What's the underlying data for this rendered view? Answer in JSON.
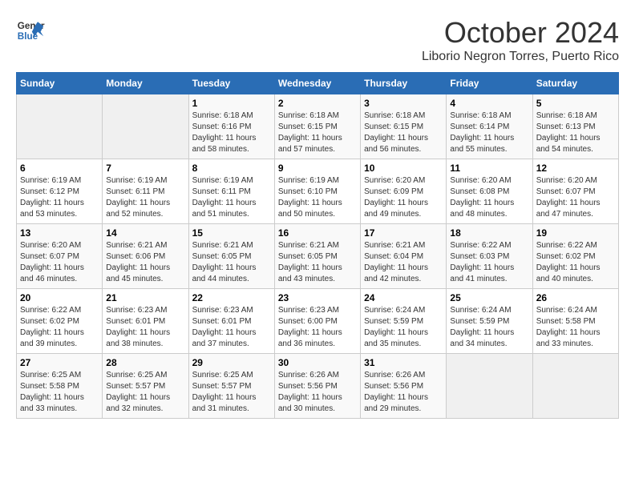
{
  "header": {
    "logo_line1": "General",
    "logo_line2": "Blue",
    "month": "October 2024",
    "location": "Liborio Negron Torres, Puerto Rico"
  },
  "days_of_week": [
    "Sunday",
    "Monday",
    "Tuesday",
    "Wednesday",
    "Thursday",
    "Friday",
    "Saturday"
  ],
  "weeks": [
    [
      {
        "day": "",
        "info": ""
      },
      {
        "day": "",
        "info": ""
      },
      {
        "day": "1",
        "info": "Sunrise: 6:18 AM\nSunset: 6:16 PM\nDaylight: 11 hours and 58 minutes."
      },
      {
        "day": "2",
        "info": "Sunrise: 6:18 AM\nSunset: 6:15 PM\nDaylight: 11 hours and 57 minutes."
      },
      {
        "day": "3",
        "info": "Sunrise: 6:18 AM\nSunset: 6:15 PM\nDaylight: 11 hours and 56 minutes."
      },
      {
        "day": "4",
        "info": "Sunrise: 6:18 AM\nSunset: 6:14 PM\nDaylight: 11 hours and 55 minutes."
      },
      {
        "day": "5",
        "info": "Sunrise: 6:18 AM\nSunset: 6:13 PM\nDaylight: 11 hours and 54 minutes."
      }
    ],
    [
      {
        "day": "6",
        "info": "Sunrise: 6:19 AM\nSunset: 6:12 PM\nDaylight: 11 hours and 53 minutes."
      },
      {
        "day": "7",
        "info": "Sunrise: 6:19 AM\nSunset: 6:11 PM\nDaylight: 11 hours and 52 minutes."
      },
      {
        "day": "8",
        "info": "Sunrise: 6:19 AM\nSunset: 6:11 PM\nDaylight: 11 hours and 51 minutes."
      },
      {
        "day": "9",
        "info": "Sunrise: 6:19 AM\nSunset: 6:10 PM\nDaylight: 11 hours and 50 minutes."
      },
      {
        "day": "10",
        "info": "Sunrise: 6:20 AM\nSunset: 6:09 PM\nDaylight: 11 hours and 49 minutes."
      },
      {
        "day": "11",
        "info": "Sunrise: 6:20 AM\nSunset: 6:08 PM\nDaylight: 11 hours and 48 minutes."
      },
      {
        "day": "12",
        "info": "Sunrise: 6:20 AM\nSunset: 6:07 PM\nDaylight: 11 hours and 47 minutes."
      }
    ],
    [
      {
        "day": "13",
        "info": "Sunrise: 6:20 AM\nSunset: 6:07 PM\nDaylight: 11 hours and 46 minutes."
      },
      {
        "day": "14",
        "info": "Sunrise: 6:21 AM\nSunset: 6:06 PM\nDaylight: 11 hours and 45 minutes."
      },
      {
        "day": "15",
        "info": "Sunrise: 6:21 AM\nSunset: 6:05 PM\nDaylight: 11 hours and 44 minutes."
      },
      {
        "day": "16",
        "info": "Sunrise: 6:21 AM\nSunset: 6:05 PM\nDaylight: 11 hours and 43 minutes."
      },
      {
        "day": "17",
        "info": "Sunrise: 6:21 AM\nSunset: 6:04 PM\nDaylight: 11 hours and 42 minutes."
      },
      {
        "day": "18",
        "info": "Sunrise: 6:22 AM\nSunset: 6:03 PM\nDaylight: 11 hours and 41 minutes."
      },
      {
        "day": "19",
        "info": "Sunrise: 6:22 AM\nSunset: 6:02 PM\nDaylight: 11 hours and 40 minutes."
      }
    ],
    [
      {
        "day": "20",
        "info": "Sunrise: 6:22 AM\nSunset: 6:02 PM\nDaylight: 11 hours and 39 minutes."
      },
      {
        "day": "21",
        "info": "Sunrise: 6:23 AM\nSunset: 6:01 PM\nDaylight: 11 hours and 38 minutes."
      },
      {
        "day": "22",
        "info": "Sunrise: 6:23 AM\nSunset: 6:01 PM\nDaylight: 11 hours and 37 minutes."
      },
      {
        "day": "23",
        "info": "Sunrise: 6:23 AM\nSunset: 6:00 PM\nDaylight: 11 hours and 36 minutes."
      },
      {
        "day": "24",
        "info": "Sunrise: 6:24 AM\nSunset: 5:59 PM\nDaylight: 11 hours and 35 minutes."
      },
      {
        "day": "25",
        "info": "Sunrise: 6:24 AM\nSunset: 5:59 PM\nDaylight: 11 hours and 34 minutes."
      },
      {
        "day": "26",
        "info": "Sunrise: 6:24 AM\nSunset: 5:58 PM\nDaylight: 11 hours and 33 minutes."
      }
    ],
    [
      {
        "day": "27",
        "info": "Sunrise: 6:25 AM\nSunset: 5:58 PM\nDaylight: 11 hours and 33 minutes."
      },
      {
        "day": "28",
        "info": "Sunrise: 6:25 AM\nSunset: 5:57 PM\nDaylight: 11 hours and 32 minutes."
      },
      {
        "day": "29",
        "info": "Sunrise: 6:25 AM\nSunset: 5:57 PM\nDaylight: 11 hours and 31 minutes."
      },
      {
        "day": "30",
        "info": "Sunrise: 6:26 AM\nSunset: 5:56 PM\nDaylight: 11 hours and 30 minutes."
      },
      {
        "day": "31",
        "info": "Sunrise: 6:26 AM\nSunset: 5:56 PM\nDaylight: 11 hours and 29 minutes."
      },
      {
        "day": "",
        "info": ""
      },
      {
        "day": "",
        "info": ""
      }
    ]
  ]
}
